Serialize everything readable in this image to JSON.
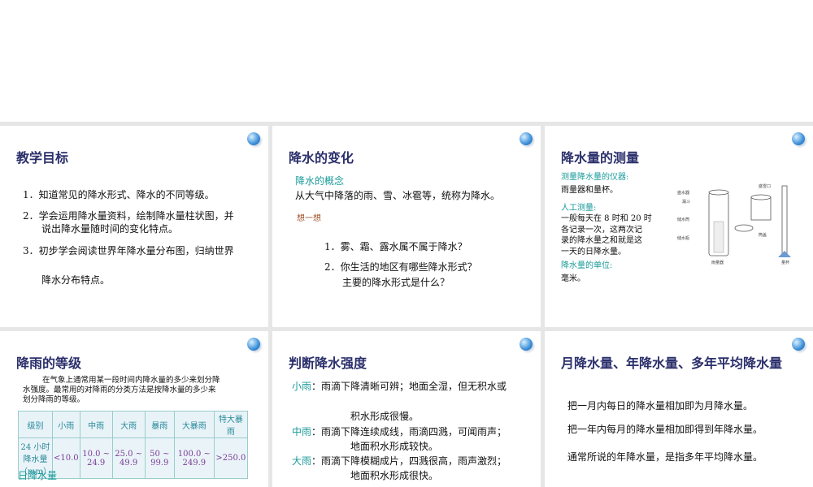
{
  "slides": [
    {
      "title": "教学目标",
      "items": [
        "1．知道常见的降水形式、降水的不同等级。",
        "2．学会运用降水量资料，绘制降水量柱状图，并",
        "说出降水量随时间的变化特点。",
        "3．初步学会阅读世界年降水量分布图，归纳世界",
        "降水分布特点。"
      ]
    },
    {
      "title": "降水的变化",
      "concept_label": "降水的概念",
      "concept": "从大气中降落的雨、雪、冰雹等，统称为降水。",
      "think": "想一想",
      "q1": "1．雾、霜、露水属不属于降水？",
      "q2": "2．你生活的地区有哪些降水形式？",
      "q2b": "主要的降水形式是什么？"
    },
    {
      "title": "降水量的测量",
      "l1": "测量降水量的仪器:",
      "t1": "雨量器和量杯。",
      "l2": "人工测量:",
      "t2": [
        "一般每天在 8 时和 20 时",
        "各记录一次，这两次记",
        "录的降水量之和就是这",
        "一天的日降水量。"
      ],
      "l3": "降水量的单位:",
      "t3": "毫米。",
      "diagram": {
        "labels": [
          "盛水器",
          "漏斗",
          "储水筒",
          "储水瓶",
          "雨量器",
          "盛雪口",
          "筒盖",
          "量杯"
        ]
      }
    },
    {
      "title": "降雨的等级",
      "intro": [
        "在气象上通常用某一段时间内降水量的多少来划分降",
        "水强度。最常用的对降雨的分类方法是按降水量的多少来",
        "划分降雨的等级。"
      ],
      "table": {
        "headers": [
          "级别",
          "小雨",
          "中雨",
          "大雨",
          "暴雨",
          "大暴雨",
          "特大暴雨"
        ],
        "row_label": "24 小时降水量（mm）",
        "values": [
          "<10.0",
          "10.0 ~ 24.9",
          "25.0 ~ 49.9",
          "50 ~ 99.9",
          "100.0 ~ 249.9",
          ">250.0"
        ]
      },
      "footer": "日降水量"
    },
    {
      "title": "判断降水强度",
      "rows": [
        {
          "label": "小雨",
          "text": "：雨滴下降清晰可辨；地面全湿，但无积水或",
          "cont": "积水形成很慢。"
        },
        {
          "label": "中雨",
          "text": "：雨滴下降连续成线，雨滴四溅，可闻雨声；",
          "cont": "地面积水形成较快。"
        },
        {
          "label": "大雨",
          "text": "：雨滴下降模糊成片，四溅很高，雨声激烈；",
          "cont": "地面积水形成很快。"
        }
      ]
    },
    {
      "title": "月降水量、年降水量、多年平均降水量",
      "lines": [
        "把一月内每日的降水量相加即为月降水量。",
        "把一年内每月的降水量相加即得到年降水量。",
        "通常所说的年降水量，是指多年平均降水量。"
      ]
    }
  ]
}
